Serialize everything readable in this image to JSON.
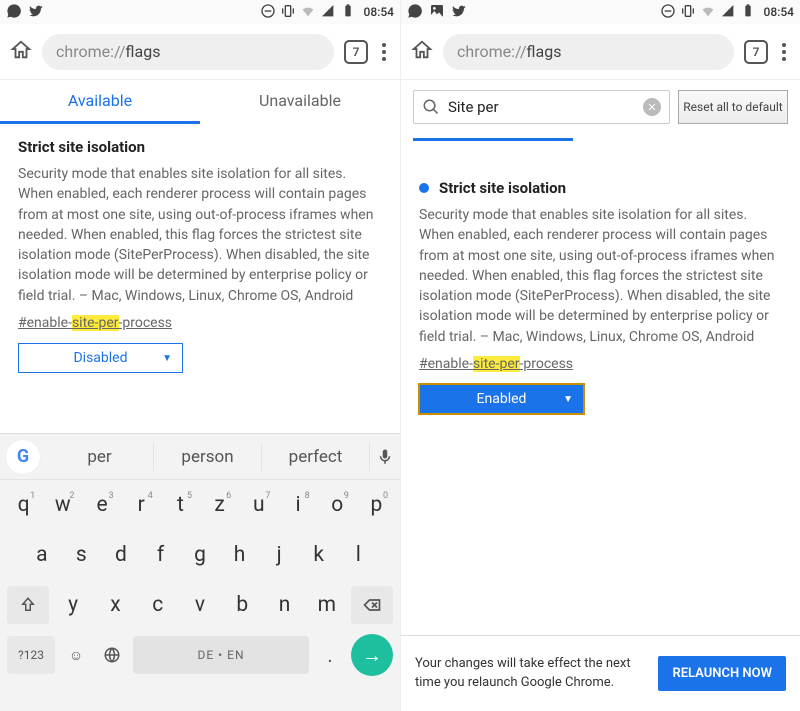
{
  "status": {
    "time": "08:54"
  },
  "addr": {
    "url_prefix": "chrome://",
    "url_bold": "flags",
    "tabcount": "7"
  },
  "tabs": {
    "available": "Available",
    "unavailable": "Unavailable"
  },
  "flag": {
    "title": "Strict site isolation",
    "desc": "Security mode that enables site isolation for all sites. When enabled, each renderer process will contain pages from at most one site, using out-of-process iframes when needed. When enabled, this flag forces the strictest site isolation mode (SitePerProcess). When disabled, the site isolation mode will be determined by enterprise policy or field trial. – Mac, Windows, Linux, Chrome OS, Android",
    "link_pre": "#enable-",
    "link_hl": "site-per",
    "link_post": "-process",
    "dropdown_disabled": "Disabled",
    "dropdown_enabled": "Enabled"
  },
  "search": {
    "value": "Site per",
    "reset": "Reset all to default"
  },
  "relaunch": {
    "text": "Your changes will take effect the next time you relaunch Google Chrome.",
    "btn": "RELAUNCH NOW"
  },
  "kbd": {
    "sugg": [
      "per",
      "person",
      "perfect"
    ],
    "row1": [
      "q",
      "w",
      "e",
      "r",
      "t",
      "z",
      "u",
      "i",
      "o",
      "p"
    ],
    "nums": [
      "1",
      "2",
      "3",
      "4",
      "5",
      "6",
      "7",
      "8",
      "9",
      "0"
    ],
    "row2": [
      "a",
      "s",
      "d",
      "f",
      "g",
      "h",
      "j",
      "k",
      "l"
    ],
    "row3": [
      "y",
      "x",
      "c",
      "v",
      "b",
      "n",
      "m"
    ],
    "numkey": "?123",
    "space": "DE • EN"
  }
}
